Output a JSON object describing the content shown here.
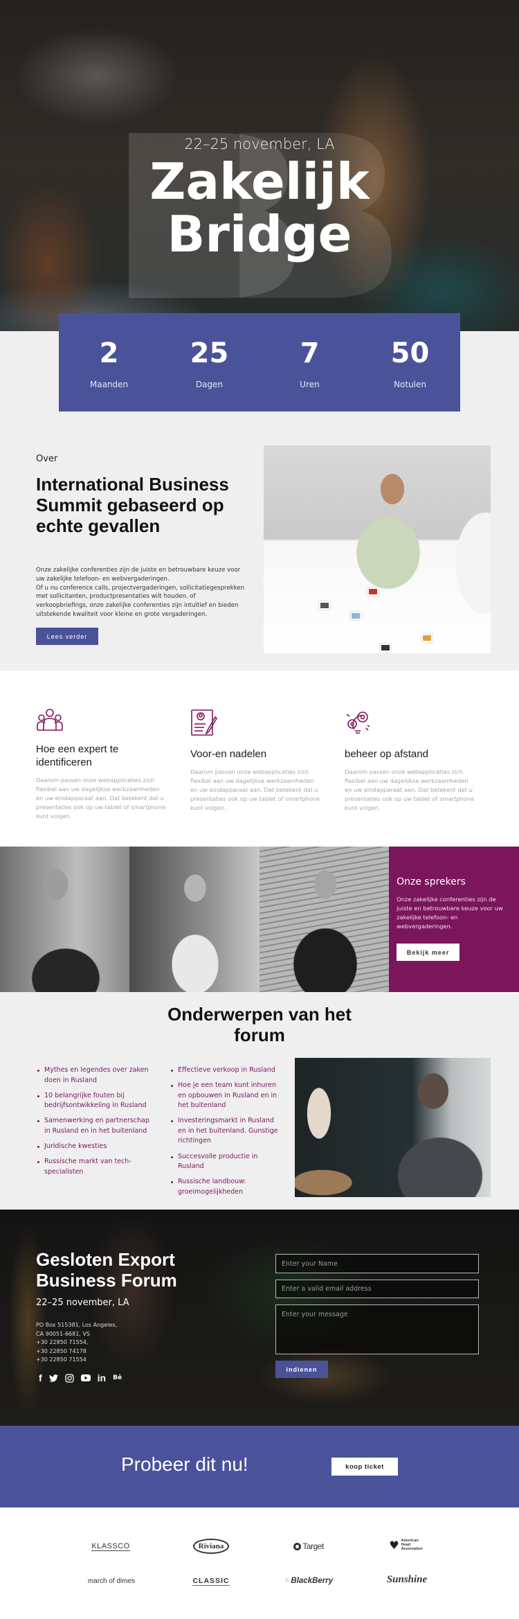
{
  "hero": {
    "date": "22–25 november, LA",
    "title_line1": "Zakelijk",
    "title_line2": "Bridge"
  },
  "counter": [
    {
      "value": "2",
      "label": "Maanden"
    },
    {
      "value": "25",
      "label": "Dagen"
    },
    {
      "value": "7",
      "label": "Uren"
    },
    {
      "value": "50",
      "label": "Notulen"
    }
  ],
  "about": {
    "kicker": "Over",
    "title": "International Business Summit gebaseerd op echte gevallen",
    "text_1": "Onze zakelijke conferenties zijn de juiste en betrouwbare keuze voor uw zakelijke telefoon- en webvergaderingen.",
    "text_2": "Of u nu conference calls, projectvergaderingen, sollicitatiegesprekken met sollicitanten, productpresentaties wilt houden. of verkoopbriefings, onze zakelijke conferenties zijn intuïtief en bieden uitstekende kwaliteit voor kleine en grote vergaderingen.",
    "button": "Lees verder"
  },
  "features": [
    {
      "icon": "team-icon",
      "title": "Hoe een expert te identificeren",
      "text": "Daarom passen onze webapplicaties zich flexibel aan uw dagelijkse werkzaamheden en uw eindapparaat aan. Dat betekent dat u presentaties ook op uw tablet of smartphone kunt volgen."
    },
    {
      "icon": "resume-pen-icon",
      "title": "Voor-en nadelen",
      "text": "Daarom passen onze webapplicaties zich flexibel aan uw dagelijkse werkzaamheden en uw eindapparaat aan. Dat betekent dat u presentaties ook op uw tablet of smartphone kunt volgen."
    },
    {
      "icon": "lightbulb-gears-icon",
      "title": "beheer op afstand",
      "text": "Daarom passen onze webapplicaties zich flexibel aan uw dagelijkse werkzaamheden en uw eindapparaat aan. Dat betekent dat u presentaties ook op uw tablet of smartphone kunt volgen."
    }
  ],
  "speakers": {
    "title": "Onze sprekers",
    "text": "Onze zakelijke conferenties zijn de juiste en betrouwbare keuze voor uw zakelijke telefoon- en webvergaderingen.",
    "button": "Bekijk meer"
  },
  "topics": {
    "title_line1": "Onderwerpen van het",
    "title_line2": "forum",
    "left": [
      "Mythes en legendes over zaken doen in Rusland",
      "10 belangrijke fouten bij bedrijfsontwikkeling in Rusland",
      "Samenwerking en partnerschap in Rusland en in het buitenland",
      "Juridische kwesties",
      "Russische markt van tech-specialisten"
    ],
    "right": [
      "Effectieve verkoop in Rusland",
      "Hoe je een team kunt inhuren en opbouwen in Rusland en in het buitenland",
      "Investeringsmarkt in Rusland en in het buitenland. Gunstige richtingen",
      "Succesvolle productie in Rusland",
      "Russische landbouw: groeimogelijkheden"
    ]
  },
  "contact": {
    "title_line1": "Gesloten Export",
    "title_line2": "Business Forum",
    "date": "22–25 november, LA",
    "address": [
      "PO Box 515381, Los Angeles,",
      "CA 90051-6681, VS",
      "+30 22850 71554,",
      "+30 22850 74178",
      "+30 22850 71554"
    ],
    "social": [
      {
        "name": "facebook-icon",
        "glyph": "f"
      },
      {
        "name": "twitter-icon",
        "glyph": "🐦"
      },
      {
        "name": "instagram-icon",
        "glyph": "◎"
      },
      {
        "name": "youtube-icon",
        "glyph": "▶"
      },
      {
        "name": "linkedin-icon",
        "glyph": "in"
      },
      {
        "name": "behance-icon",
        "glyph": "Bē"
      }
    ],
    "form": {
      "name_placeholder": "Enter your Name",
      "email_placeholder": "Enter a valid email address",
      "message_placeholder": "Enter your message",
      "submit": "indienen"
    }
  },
  "cta": {
    "text": "Probeer dit nu!",
    "button": "koop ticket"
  },
  "logos": [
    "KLASSCO",
    "Riviana",
    "Target",
    "American Heart Association",
    "march of dimes",
    "CLASSIC",
    "BlackBerry",
    "Sunshine"
  ],
  "colors": {
    "primary": "#4a539a",
    "accent": "#7b165c",
    "light_bg": "#efefef"
  }
}
